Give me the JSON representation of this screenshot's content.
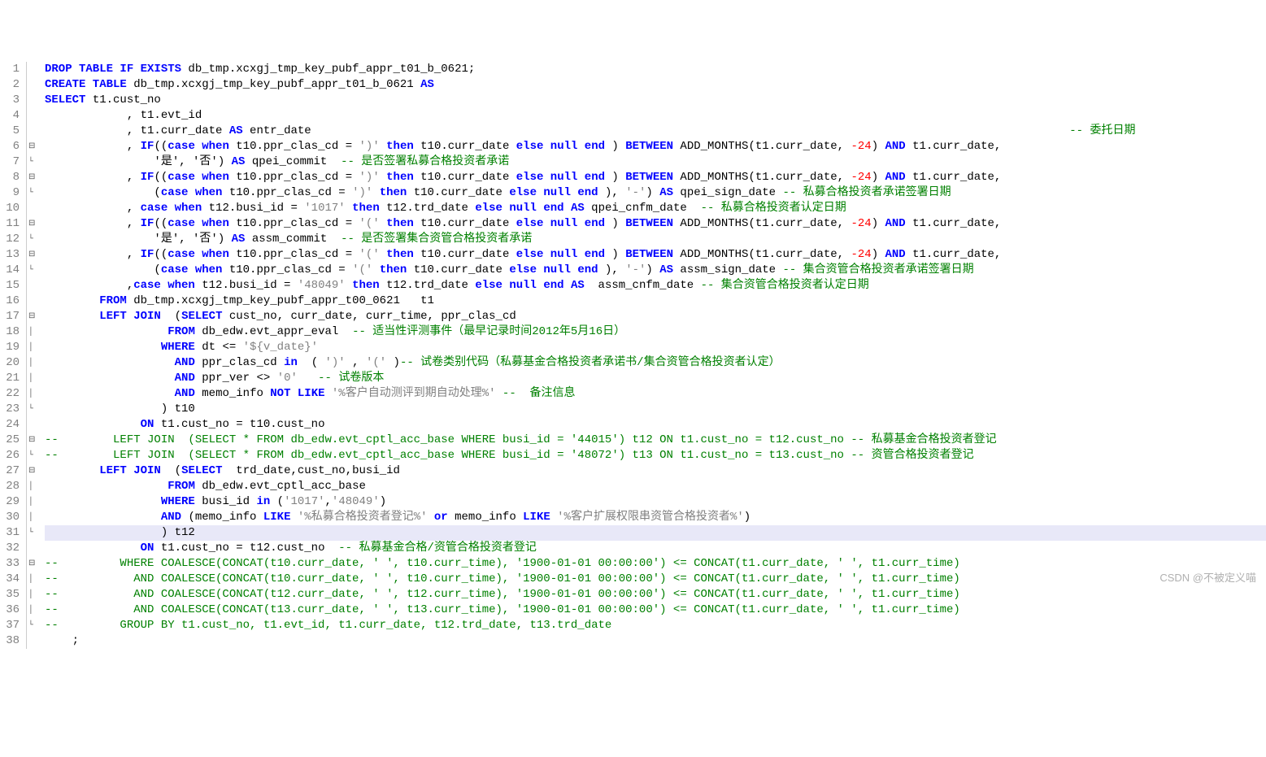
{
  "watermark": "CSDN @不被定义喵",
  "lines": [
    {
      "n": 1,
      "fold": "",
      "tokens": [
        [
          "kw",
          "DROP TABLE IF EXISTS"
        ],
        [
          "s",
          " db_tmp.xcxgj_tmp_key_pubf_appr_t01_b_0621;"
        ]
      ]
    },
    {
      "n": 2,
      "fold": "",
      "tokens": [
        [
          "kw",
          "CREATE TABLE"
        ],
        [
          "s",
          " db_tmp.xcxgj_tmp_key_pubf_appr_t01_b_0621 "
        ],
        [
          "kw",
          "AS"
        ]
      ]
    },
    {
      "n": 3,
      "fold": "",
      "tokens": [
        [
          "kw",
          "SELECT"
        ],
        [
          "s",
          " t1.cust_no"
        ]
      ]
    },
    {
      "n": 4,
      "fold": "",
      "tokens": [
        [
          "s",
          "            , t1.evt_id"
        ]
      ]
    },
    {
      "n": 5,
      "fold": "",
      "tokens": [
        [
          "s",
          "            , t1.curr_date "
        ],
        [
          "kw",
          "AS"
        ],
        [
          "s",
          " entr_date                                                                                                               "
        ],
        [
          "cmt",
          "-- 委托日期"
        ]
      ]
    },
    {
      "n": 6,
      "fold": "⊟",
      "tokens": [
        [
          "s",
          "            , "
        ],
        [
          "kw",
          "IF"
        ],
        [
          "s",
          "(("
        ],
        [
          "kw",
          "case when"
        ],
        [
          "s",
          " t10.ppr_clas_cd = "
        ],
        [
          "str",
          "')'"
        ],
        [
          "s",
          " "
        ],
        [
          "kw",
          "then"
        ],
        [
          "s",
          " t10.curr_date "
        ],
        [
          "kw",
          "else null end"
        ],
        [
          "s",
          " ) "
        ],
        [
          "kw",
          "BETWEEN"
        ],
        [
          "s",
          " ADD_MONTHS(t1.curr_date, "
        ],
        [
          "num",
          "-24"
        ],
        [
          "s",
          ") "
        ],
        [
          "kw",
          "AND"
        ],
        [
          "s",
          " t1.curr_date,"
        ]
      ]
    },
    {
      "n": 7,
      "fold": "└",
      "tokens": [
        [
          "s",
          "                '是', '否') "
        ],
        [
          "kw",
          "AS"
        ],
        [
          "s",
          " qpei_commit  "
        ],
        [
          "cmt",
          "-- 是否签署私募合格投资者承诺"
        ]
      ]
    },
    {
      "n": 8,
      "fold": "⊟",
      "tokens": [
        [
          "s",
          "            , "
        ],
        [
          "kw",
          "IF"
        ],
        [
          "s",
          "(("
        ],
        [
          "kw",
          "case when"
        ],
        [
          "s",
          " t10.ppr_clas_cd = "
        ],
        [
          "str",
          "')'"
        ],
        [
          "s",
          " "
        ],
        [
          "kw",
          "then"
        ],
        [
          "s",
          " t10.curr_date "
        ],
        [
          "kw",
          "else null end"
        ],
        [
          "s",
          " ) "
        ],
        [
          "kw",
          "BETWEEN"
        ],
        [
          "s",
          " ADD_MONTHS(t1.curr_date, "
        ],
        [
          "num",
          "-24"
        ],
        [
          "s",
          ") "
        ],
        [
          "kw",
          "AND"
        ],
        [
          "s",
          " t1.curr_date,"
        ]
      ]
    },
    {
      "n": 9,
      "fold": "└",
      "tokens": [
        [
          "s",
          "                ("
        ],
        [
          "kw",
          "case when"
        ],
        [
          "s",
          " t10.ppr_clas_cd = "
        ],
        [
          "str",
          "')'"
        ],
        [
          "s",
          " "
        ],
        [
          "kw",
          "then"
        ],
        [
          "s",
          " t10.curr_date "
        ],
        [
          "kw",
          "else null end"
        ],
        [
          "s",
          " ), "
        ],
        [
          "str",
          "'-'"
        ],
        [
          "s",
          ") "
        ],
        [
          "kw",
          "AS"
        ],
        [
          "s",
          " qpei_sign_date "
        ],
        [
          "cmt",
          "-- 私募合格投资者承诺签署日期"
        ]
      ]
    },
    {
      "n": 10,
      "fold": "",
      "tokens": [
        [
          "s",
          "            , "
        ],
        [
          "kw",
          "case when"
        ],
        [
          "s",
          " t12.busi_id = "
        ],
        [
          "str",
          "'1017'"
        ],
        [
          "s",
          " "
        ],
        [
          "kw",
          "then"
        ],
        [
          "s",
          " t12.trd_date "
        ],
        [
          "kw",
          "else null end AS"
        ],
        [
          "s",
          " qpei_cnfm_date  "
        ],
        [
          "cmt",
          "-- 私募合格投资者认定日期"
        ]
      ]
    },
    {
      "n": 11,
      "fold": "⊟",
      "tokens": [
        [
          "s",
          "            , "
        ],
        [
          "kw",
          "IF"
        ],
        [
          "s",
          "(("
        ],
        [
          "kw",
          "case when"
        ],
        [
          "s",
          " t10.ppr_clas_cd = "
        ],
        [
          "str",
          "'('"
        ],
        [
          "s",
          " "
        ],
        [
          "kw",
          "then"
        ],
        [
          "s",
          " t10.curr_date "
        ],
        [
          "kw",
          "else null end"
        ],
        [
          "s",
          " ) "
        ],
        [
          "kw",
          "BETWEEN"
        ],
        [
          "s",
          " ADD_MONTHS(t1.curr_date, "
        ],
        [
          "num",
          "-24"
        ],
        [
          "s",
          ") "
        ],
        [
          "kw",
          "AND"
        ],
        [
          "s",
          " t1.curr_date,"
        ]
      ]
    },
    {
      "n": 12,
      "fold": "└",
      "tokens": [
        [
          "s",
          "                '是', '否') "
        ],
        [
          "kw",
          "AS"
        ],
        [
          "s",
          " assm_commit  "
        ],
        [
          "cmt",
          "-- 是否签署集合资管合格投资者承诺"
        ]
      ]
    },
    {
      "n": 13,
      "fold": "⊟",
      "tokens": [
        [
          "s",
          "            , "
        ],
        [
          "kw",
          "IF"
        ],
        [
          "s",
          "(("
        ],
        [
          "kw",
          "case when"
        ],
        [
          "s",
          " t10.ppr_clas_cd = "
        ],
        [
          "str",
          "'('"
        ],
        [
          "s",
          " "
        ],
        [
          "kw",
          "then"
        ],
        [
          "s",
          " t10.curr_date "
        ],
        [
          "kw",
          "else null end"
        ],
        [
          "s",
          " ) "
        ],
        [
          "kw",
          "BETWEEN"
        ],
        [
          "s",
          " ADD_MONTHS(t1.curr_date, "
        ],
        [
          "num",
          "-24"
        ],
        [
          "s",
          ") "
        ],
        [
          "kw",
          "AND"
        ],
        [
          "s",
          " t1.curr_date,"
        ]
      ]
    },
    {
      "n": 14,
      "fold": "└",
      "tokens": [
        [
          "s",
          "                ("
        ],
        [
          "kw",
          "case when"
        ],
        [
          "s",
          " t10.ppr_clas_cd = "
        ],
        [
          "str",
          "'('"
        ],
        [
          "s",
          " "
        ],
        [
          "kw",
          "then"
        ],
        [
          "s",
          " t10.curr_date "
        ],
        [
          "kw",
          "else null end"
        ],
        [
          "s",
          " ), "
        ],
        [
          "str",
          "'-'"
        ],
        [
          "s",
          ") "
        ],
        [
          "kw",
          "AS"
        ],
        [
          "s",
          " assm_sign_date "
        ],
        [
          "cmt",
          "-- 集合资管合格投资者承诺签署日期"
        ]
      ]
    },
    {
      "n": 15,
      "fold": "",
      "tokens": [
        [
          "s",
          "            ,"
        ],
        [
          "kw",
          "case when"
        ],
        [
          "s",
          " t12.busi_id = "
        ],
        [
          "str",
          "'48049'"
        ],
        [
          "s",
          " "
        ],
        [
          "kw",
          "then"
        ],
        [
          "s",
          " t12.trd_date "
        ],
        [
          "kw",
          "else null end AS"
        ],
        [
          "s",
          "  assm_cnfm_date "
        ],
        [
          "cmt",
          "-- 集合资管合格投资者认定日期"
        ]
      ]
    },
    {
      "n": 16,
      "fold": "",
      "tokens": [
        [
          "s",
          "        "
        ],
        [
          "kw",
          "FROM"
        ],
        [
          "s",
          " db_tmp.xcxgj_tmp_key_pubf_appr_t00_0621   t1"
        ]
      ]
    },
    {
      "n": 17,
      "fold": "⊟",
      "tokens": [
        [
          "s",
          "        "
        ],
        [
          "kw",
          "LEFT JOIN"
        ],
        [
          "s",
          "  ("
        ],
        [
          "kw",
          "SELECT"
        ],
        [
          "s",
          " cust_no, curr_date, curr_time, ppr_clas_cd"
        ]
      ]
    },
    {
      "n": 18,
      "fold": "|",
      "tokens": [
        [
          "s",
          "                  "
        ],
        [
          "kw",
          "FROM"
        ],
        [
          "s",
          " db_edw.evt_appr_eval  "
        ],
        [
          "cmt",
          "-- 适当性评测事件（最早记录时间2012年5月16日）"
        ]
      ]
    },
    {
      "n": 19,
      "fold": "|",
      "tokens": [
        [
          "s",
          "                 "
        ],
        [
          "kw",
          "WHERE"
        ],
        [
          "s",
          " dt <= "
        ],
        [
          "str",
          "'${v_date}'"
        ]
      ]
    },
    {
      "n": 20,
      "fold": "|",
      "tokens": [
        [
          "s",
          "                   "
        ],
        [
          "kw",
          "AND"
        ],
        [
          "s",
          " ppr_clas_cd "
        ],
        [
          "kw",
          "in"
        ],
        [
          "s",
          "  ( "
        ],
        [
          "str",
          "')'"
        ],
        [
          "s",
          " , "
        ],
        [
          "str",
          "'('"
        ],
        [
          "s",
          " )"
        ],
        [
          "cmt",
          "-- 试卷类别代码（私募基金合格投资者承诺书/集合资管合格投资者认定）"
        ]
      ]
    },
    {
      "n": 21,
      "fold": "|",
      "tokens": [
        [
          "s",
          "                   "
        ],
        [
          "kw",
          "AND"
        ],
        [
          "s",
          " ppr_ver <> "
        ],
        [
          "str",
          "'0'"
        ],
        [
          "s",
          "   "
        ],
        [
          "cmt",
          "-- 试卷版本"
        ]
      ]
    },
    {
      "n": 22,
      "fold": "|",
      "tokens": [
        [
          "s",
          "                   "
        ],
        [
          "kw",
          "AND"
        ],
        [
          "s",
          " memo_info "
        ],
        [
          "kw",
          "NOT LIKE"
        ],
        [
          "s",
          " "
        ],
        [
          "str",
          "'%客户自动测评到期自动处理%'"
        ],
        [
          "s",
          " "
        ],
        [
          "cmt",
          "--  备注信息"
        ]
      ]
    },
    {
      "n": 23,
      "fold": "└",
      "tokens": [
        [
          "s",
          "                 ) t10"
        ]
      ]
    },
    {
      "n": 24,
      "fold": "",
      "tokens": [
        [
          "s",
          "              "
        ],
        [
          "kw",
          "ON"
        ],
        [
          "s",
          " t1.cust_no = t10.cust_no"
        ]
      ]
    },
    {
      "n": 25,
      "fold": "⊟",
      "tokens": [
        [
          "cmt",
          "--        LEFT JOIN  (SELECT * FROM db_edw.evt_cptl_acc_base WHERE busi_id = '44015') t12 ON t1.cust_no = t12.cust_no -- 私募基金合格投资者登记"
        ]
      ]
    },
    {
      "n": 26,
      "fold": "└",
      "tokens": [
        [
          "cmt",
          "--        LEFT JOIN  (SELECT * FROM db_edw.evt_cptl_acc_base WHERE busi_id = '48072') t13 ON t1.cust_no = t13.cust_no -- 资管合格投资者登记"
        ]
      ]
    },
    {
      "n": 27,
      "fold": "⊟",
      "tokens": [
        [
          "s",
          "        "
        ],
        [
          "kw",
          "LEFT JOIN"
        ],
        [
          "s",
          "  ("
        ],
        [
          "kw",
          "SELECT"
        ],
        [
          "s",
          "  trd_date,cust_no,busi_id"
        ]
      ]
    },
    {
      "n": 28,
      "fold": "|",
      "tokens": [
        [
          "s",
          "                  "
        ],
        [
          "kw",
          "FROM"
        ],
        [
          "s",
          " db_edw.evt_cptl_acc_base"
        ]
      ]
    },
    {
      "n": 29,
      "fold": "|",
      "tokens": [
        [
          "s",
          "                 "
        ],
        [
          "kw",
          "WHERE"
        ],
        [
          "s",
          " busi_id "
        ],
        [
          "kw",
          "in"
        ],
        [
          "s",
          " ("
        ],
        [
          "str",
          "'1017'"
        ],
        [
          "s",
          ","
        ],
        [
          "str",
          "'48049'"
        ],
        [
          "s",
          ")"
        ]
      ]
    },
    {
      "n": 30,
      "fold": "|",
      "tokens": [
        [
          "s",
          "                 "
        ],
        [
          "kw",
          "AND"
        ],
        [
          "s",
          " (memo_info "
        ],
        [
          "kw",
          "LIKE"
        ],
        [
          "s",
          " "
        ],
        [
          "str",
          "'%私募合格投资者登记%'"
        ],
        [
          "s",
          " "
        ],
        [
          "kw",
          "or"
        ],
        [
          "s",
          " memo_info "
        ],
        [
          "kw",
          "LIKE"
        ],
        [
          "s",
          " "
        ],
        [
          "str",
          "'%客户扩展权限串资管合格投资者%'"
        ],
        [
          "s",
          ")"
        ]
      ]
    },
    {
      "n": 31,
      "fold": "└",
      "hl": true,
      "tokens": [
        [
          "s",
          "                 ) t12"
        ]
      ]
    },
    {
      "n": 32,
      "fold": "",
      "tokens": [
        [
          "s",
          "              "
        ],
        [
          "kw",
          "ON"
        ],
        [
          "s",
          " t1.cust_no = t12.cust_no  "
        ],
        [
          "cmt",
          "-- 私募基金合格/资管合格投资者登记"
        ]
      ]
    },
    {
      "n": 33,
      "fold": "⊟",
      "tokens": [
        [
          "cmt",
          "--         WHERE COALESCE(CONCAT(t10.curr_date, ' ', t10.curr_time), '1900-01-01 00:00:00') <= CONCAT(t1.curr_date, ' ', t1.curr_time)"
        ]
      ]
    },
    {
      "n": 34,
      "fold": "|",
      "tokens": [
        [
          "cmt",
          "--           AND COALESCE(CONCAT(t10.curr_date, ' ', t10.curr_time), '1900-01-01 00:00:00') <= CONCAT(t1.curr_date, ' ', t1.curr_time)"
        ]
      ]
    },
    {
      "n": 35,
      "fold": "|",
      "tokens": [
        [
          "cmt",
          "--           AND COALESCE(CONCAT(t12.curr_date, ' ', t12.curr_time), '1900-01-01 00:00:00') <= CONCAT(t1.curr_date, ' ', t1.curr_time)"
        ]
      ]
    },
    {
      "n": 36,
      "fold": "|",
      "tokens": [
        [
          "cmt",
          "--           AND COALESCE(CONCAT(t13.curr_date, ' ', t13.curr_time), '1900-01-01 00:00:00') <= CONCAT(t1.curr_date, ' ', t1.curr_time)"
        ]
      ]
    },
    {
      "n": 37,
      "fold": "└",
      "tokens": [
        [
          "cmt",
          "--         GROUP BY t1.cust_no, t1.evt_id, t1.curr_date, t12.trd_date, t13.trd_date"
        ]
      ]
    },
    {
      "n": 38,
      "fold": "",
      "tokens": [
        [
          "s",
          "    ;"
        ]
      ]
    }
  ]
}
